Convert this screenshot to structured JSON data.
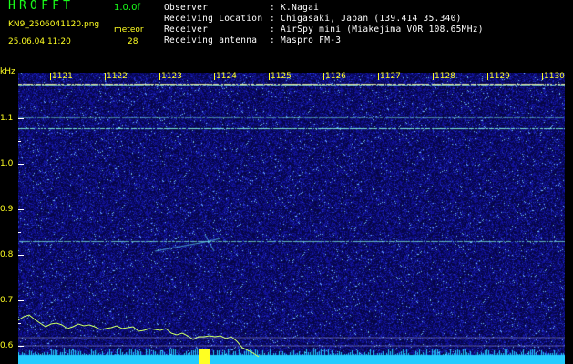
{
  "app": {
    "title": "HROFFT",
    "version": "1.0.0f"
  },
  "file": {
    "name": "KN9_2506041120.png",
    "datetime": "25.06.04 11:20"
  },
  "meteor": {
    "label": "meteor",
    "count": "28"
  },
  "info": {
    "rows": [
      {
        "label": "Observer",
        "value": ": K.Nagai"
      },
      {
        "label": "Receiving Location",
        "value": ": Chigasaki, Japan (139.414 35.340)"
      },
      {
        "label": "Receiver",
        "value": ": AirSpy mini (Miakejima VOR 108.65MHz)"
      },
      {
        "label": "Receiving antenna",
        "value": ": Maspro FM-3"
      }
    ]
  },
  "axis": {
    "unit": "kHz",
    "y_labels": [
      "1.1",
      "1.0",
      "0.9",
      "0.8",
      "0.7",
      "0.6"
    ],
    "minute_labels": [
      "1121",
      "1122",
      "1123",
      "1124",
      "1125",
      "1126",
      "1127",
      "1128",
      "1129",
      "1130"
    ]
  },
  "colors": {
    "background": "#000000",
    "spectrogram_bg": "#0b0b78",
    "title_green": "#19ff19",
    "label_yellow": "#ffff22",
    "noise_floor": "#22ccff",
    "carrier": "#88ffdd"
  }
}
